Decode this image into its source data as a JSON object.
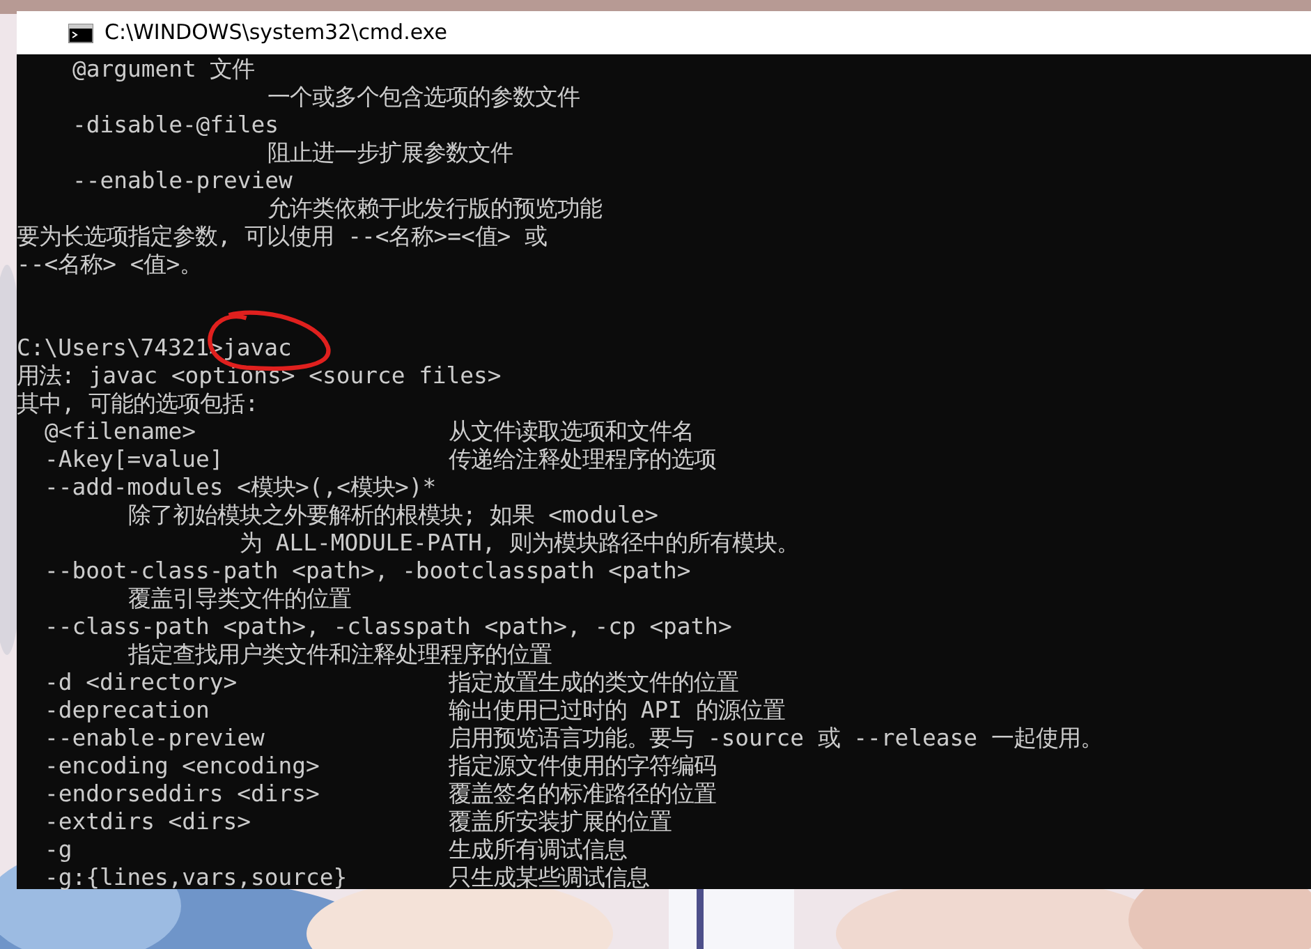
{
  "window": {
    "title": "C:\\WINDOWS\\system32\\cmd.exe"
  },
  "console": {
    "lines": [
      {
        "kind": "arg",
        "text": "@argument 文件"
      },
      {
        "kind": "arg-desc",
        "text": "一个或多个包含选项的参数文件"
      },
      {
        "kind": "arg",
        "text": "-disable-@files"
      },
      {
        "kind": "arg-desc",
        "text": "阻止进一步扩展参数文件"
      },
      {
        "kind": "arg",
        "text": "--enable-preview"
      },
      {
        "kind": "arg-desc",
        "text": "允许类依赖于此发行版的预览功能"
      },
      {
        "kind": "plain",
        "text": "要为长选项指定参数, 可以使用 --<名称>=<值> 或"
      },
      {
        "kind": "plain",
        "text": "--<名称> <值>。"
      },
      {
        "kind": "blank"
      },
      {
        "kind": "blank"
      },
      {
        "kind": "prompt",
        "path": "C:\\Users\\74321>",
        "command": "javac"
      },
      {
        "kind": "plain",
        "text": "用法: javac <options> <source files>"
      },
      {
        "kind": "plain",
        "text": "其中, 可能的选项包括:"
      },
      {
        "kind": "opt",
        "text": "@<filename>",
        "description": "从文件读取选项和文件名"
      },
      {
        "kind": "opt",
        "text": "-Akey[=value]",
        "description": "传递给注释处理程序的选项"
      },
      {
        "kind": "opt",
        "text": "--add-modules <模块>(,<模块>)*"
      },
      {
        "kind": "opt-desc",
        "text": "除了初始模块之外要解析的根模块; 如果 <module>"
      },
      {
        "kind": "opt-cont",
        "text": "为 ALL-MODULE-PATH, 则为模块路径中的所有模块。"
      },
      {
        "kind": "opt",
        "text": "--boot-class-path <path>, -bootclasspath <path>"
      },
      {
        "kind": "opt-desc",
        "text": "覆盖引导类文件的位置"
      },
      {
        "kind": "opt",
        "text": "--class-path <path>, -classpath <path>, -cp <path>"
      },
      {
        "kind": "opt-desc",
        "text": "指定查找用户类文件和注释处理程序的位置"
      },
      {
        "kind": "opt",
        "text": "-d <directory>",
        "description": "指定放置生成的类文件的位置"
      },
      {
        "kind": "opt",
        "text": "-deprecation",
        "description": "输出使用已过时的 API 的源位置"
      },
      {
        "kind": "opt",
        "text": "--enable-preview",
        "description": "启用预览语言功能。要与 -source 或 --release 一起使用。"
      },
      {
        "kind": "opt",
        "text": "-encoding <encoding>",
        "description": "指定源文件使用的字符编码"
      },
      {
        "kind": "opt",
        "text": "-endorseddirs <dirs>",
        "description": "覆盖签名的标准路径的位置"
      },
      {
        "kind": "opt",
        "text": "-extdirs <dirs>",
        "description": "覆盖所安装扩展的位置"
      },
      {
        "kind": "opt",
        "text": "-g",
        "description": "生成所有调试信息"
      },
      {
        "kind": "opt",
        "text": "-g:{lines,vars,source}",
        "description": "只生成某些调试信息"
      }
    ]
  }
}
